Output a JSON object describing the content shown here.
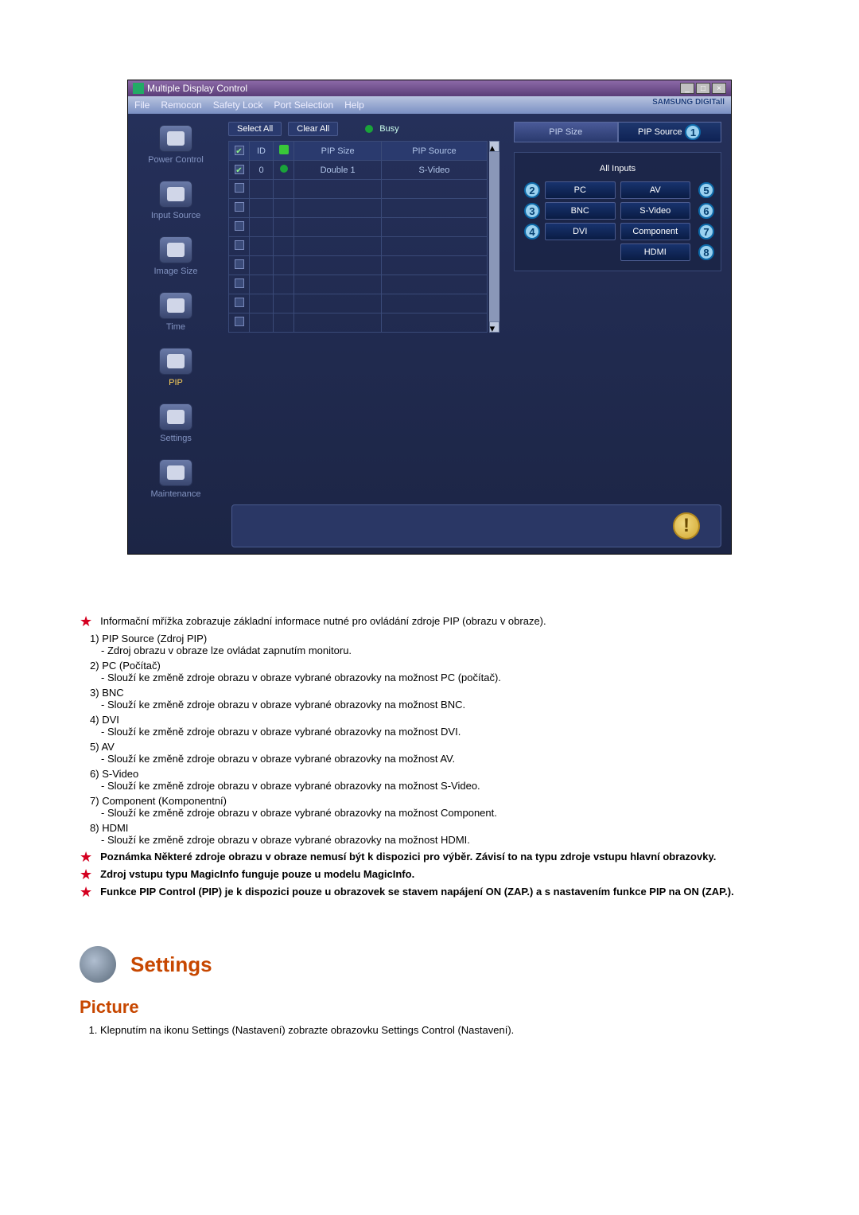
{
  "window": {
    "title": "Multiple Display Control",
    "menu": [
      "File",
      "Remocon",
      "Safety Lock",
      "Port Selection",
      "Help"
    ],
    "brand": "SAMSUNG DIGITall"
  },
  "sidebar": {
    "items": [
      {
        "label": "Power Control"
      },
      {
        "label": "Input Source"
      },
      {
        "label": "Image Size"
      },
      {
        "label": "Time"
      },
      {
        "label": "PIP"
      },
      {
        "label": "Settings"
      },
      {
        "label": "Maintenance"
      }
    ]
  },
  "toolbar": {
    "select_all": "Select All",
    "clear_all": "Clear All",
    "busy": "Busy"
  },
  "grid": {
    "headers": {
      "chk": "✔",
      "id": "ID",
      "status": "",
      "pip_size": "PIP Size",
      "pip_source": "PIP Source"
    },
    "rows": [
      {
        "checked": true,
        "id": "0",
        "status": "on",
        "pip_size": "Double 1",
        "pip_source": "S-Video"
      },
      {
        "checked": false,
        "id": "",
        "status": "",
        "pip_size": "",
        "pip_source": ""
      },
      {
        "checked": false,
        "id": "",
        "status": "",
        "pip_size": "",
        "pip_source": ""
      },
      {
        "checked": false,
        "id": "",
        "status": "",
        "pip_size": "",
        "pip_source": ""
      },
      {
        "checked": false,
        "id": "",
        "status": "",
        "pip_size": "",
        "pip_source": ""
      },
      {
        "checked": false,
        "id": "",
        "status": "",
        "pip_size": "",
        "pip_source": ""
      },
      {
        "checked": false,
        "id": "",
        "status": "",
        "pip_size": "",
        "pip_source": ""
      },
      {
        "checked": false,
        "id": "",
        "status": "",
        "pip_size": "",
        "pip_source": ""
      },
      {
        "checked": false,
        "id": "",
        "status": "",
        "pip_size": "",
        "pip_source": ""
      }
    ]
  },
  "right_panel": {
    "tab_size": "PIP Size",
    "tab_source": "PIP Source",
    "all_inputs": "All Inputs",
    "buttons": {
      "pc": "PC",
      "av": "AV",
      "bnc": "BNC",
      "svideo": "S-Video",
      "dvi": "DVI",
      "component": "Component",
      "hdmi": "HDMI"
    },
    "numbers": {
      "n1": "1",
      "n2": "2",
      "n3": "3",
      "n4": "4",
      "n5": "5",
      "n6": "6",
      "n7": "7",
      "n8": "8"
    }
  },
  "doc": {
    "starline": "Informační mřížka zobrazuje základní informace nutné pro ovládání zdroje PIP (obrazu v obraze).",
    "items": [
      {
        "n": "1)",
        "t": "PIP Source (Zdroj PIP)",
        "d": "- Zdroj obrazu v obraze lze ovládat zapnutím monitoru."
      },
      {
        "n": "2)",
        "t": "PC (Počítač)",
        "d": "- Slouží ke změně zdroje obrazu v obraze vybrané obrazovky na možnost PC (počítač)."
      },
      {
        "n": "3)",
        "t": "BNC",
        "d": "- Slouží ke změně zdroje obrazu v obraze vybrané obrazovky na možnost BNC."
      },
      {
        "n": "4)",
        "t": "DVI",
        "d": "- Slouží ke změně zdroje obrazu v obraze vybrané obrazovky na možnost DVI."
      },
      {
        "n": "5)",
        "t": "AV",
        "d": "- Slouží ke změně zdroje obrazu v obraze vybrané obrazovky na možnost AV."
      },
      {
        "n": "6)",
        "t": "S-Video",
        "d": "- Slouží ke změně zdroje obrazu v obraze vybrané obrazovky na možnost S-Video."
      },
      {
        "n": "7)",
        "t": "Component (Komponentní)",
        "d": "- Slouží ke změně zdroje obrazu v obraze vybrané obrazovky na možnost Component."
      },
      {
        "n": "8)",
        "t": "HDMI",
        "d": "- Slouží ke změně zdroje obrazu v obraze vybrané obrazovky na možnost HDMI."
      }
    ],
    "star_notes": [
      "Poznámka Některé zdroje obrazu v obraze nemusí být k dispozici pro výběr. Závisí to na typu zdroje vstupu hlavní obrazovky.",
      "Zdroj vstupu typu MagicInfo funguje pouze u modelu MagicInfo.",
      "Funkce PIP Control (PIP) je k dispozici pouze u obrazovek se stavem napájení ON (ZAP.) a s nastavením funkce PIP na ON (ZAP.)."
    ],
    "section": "Settings",
    "sub": "Picture",
    "step1": "Klepnutím na ikonu Settings (Nastavení) zobrazte obrazovku Settings Control (Nastavení)."
  }
}
